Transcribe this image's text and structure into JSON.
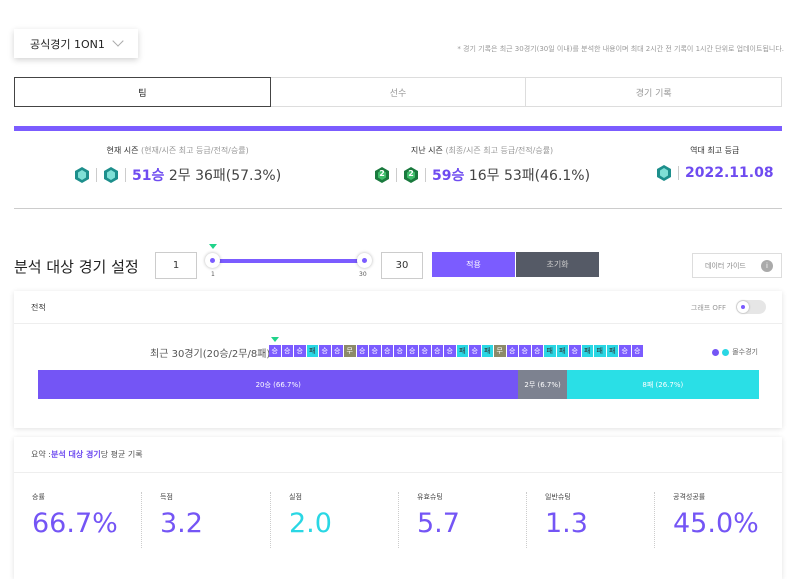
{
  "mode_select": {
    "value": "공식경기 1ON1"
  },
  "notice": "* 경기 기록은 최근 30경기(30일 이내)를 분석한 내용이며 최대 2시간 전 기록이 1시간 단위로 업데이트됩니다.",
  "tabs": [
    {
      "label": "팀",
      "active": true
    },
    {
      "label": "선수",
      "active": false
    },
    {
      "label": "경기 기록",
      "active": false
    }
  ],
  "seasons": {
    "current": {
      "label": "현재 시즌",
      "sub": "(현재/시즌 최고 등급/전적/승률)",
      "wins": "51승",
      "rest": "2무 36패(57.3%)"
    },
    "previous": {
      "label": "지난 시즌",
      "sub": "(최종/시즌 최고 등급/전적/승률)",
      "wins": "59승",
      "rest": "16무 53패(46.1%)",
      "gem_number": "2"
    },
    "best": {
      "label": "역대 최고 등급",
      "date": "2022.11.08"
    }
  },
  "analysis": {
    "title": "분석 대상 경기 설정",
    "min_value": "1",
    "max_value": "30",
    "slider_min_label": "1",
    "slider_max_label": "30",
    "apply_label": "적용",
    "reset_label": "초기화",
    "guide_label": "데이터 가이드",
    "guide_info": "i"
  },
  "record": {
    "title": "전적",
    "graph_toggle_label": "그래프 OFF",
    "recent_label": "최근 30경기(20승/2무/8패) :",
    "results": [
      "승",
      "승",
      "승",
      "패",
      "승",
      "승",
      "무",
      "승",
      "승",
      "승",
      "승",
      "승",
      "승",
      "승",
      "승",
      "패",
      "승",
      "패",
      "무",
      "승",
      "승",
      "승",
      "패",
      "패",
      "승",
      "패",
      "패",
      "패",
      "승",
      "승"
    ],
    "legend_label": "몰수경기",
    "bar": {
      "win_label": "20승 (66.7%)",
      "win_pct": 66.7,
      "draw_label": "2무 (6.7%)",
      "draw_pct": 6.7,
      "loss_label": "8패 (26.7%)",
      "loss_pct": 26.7
    }
  },
  "summary": {
    "prefix": "요약 : ",
    "highlight": "분석 대상 경기",
    "suffix": "당 평균 기록",
    "stats": [
      {
        "label": "승률",
        "value": "66.7%"
      },
      {
        "label": "득점",
        "value": "3.2"
      },
      {
        "label": "실점",
        "value": "2.0"
      },
      {
        "label": "유효슈팅",
        "value": "5.7"
      },
      {
        "label": "일반슈팅",
        "value": "1.3"
      },
      {
        "label": "공격성공률",
        "value": "45.0%"
      }
    ]
  },
  "colors": {
    "accent": "#7b5cff",
    "teal": "#2ad7e4",
    "draw": "#7d8290"
  }
}
